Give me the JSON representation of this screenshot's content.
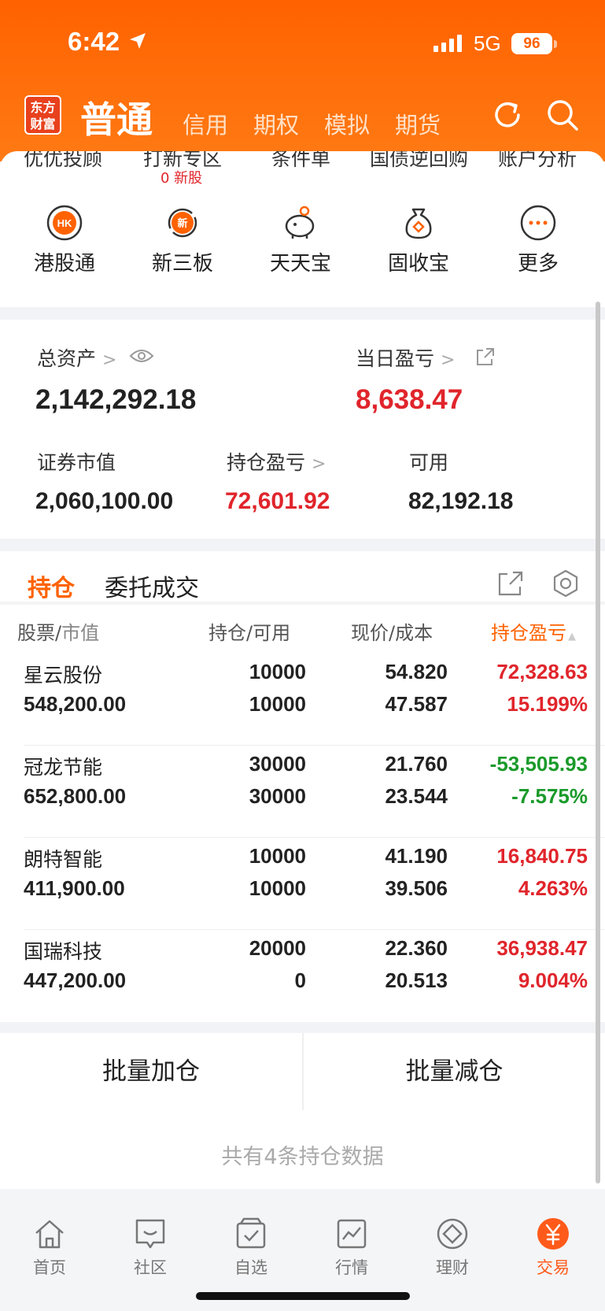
{
  "status": {
    "time": "6:42",
    "network": "5G",
    "battery": "96"
  },
  "header": {
    "logo": "东方财富",
    "tabs": [
      "普通",
      "信用",
      "期权",
      "模拟",
      "期货"
    ]
  },
  "quick": {
    "top_row": [
      "优优投顾",
      "打新专区",
      "条件单",
      "国债逆回购",
      "账户分析"
    ],
    "new_stock_count": "0 新股",
    "items": [
      {
        "label": "港股通",
        "icon": "hk-icon"
      },
      {
        "label": "新三板",
        "icon": "new-board-icon"
      },
      {
        "label": "天天宝",
        "icon": "piggy-bank-icon"
      },
      {
        "label": "固收宝",
        "icon": "money-bag-icon"
      },
      {
        "label": "更多",
        "icon": "more-icon"
      }
    ]
  },
  "assets": {
    "total_label": "总资产",
    "total_value": "2,142,292.18",
    "daily_label": "当日盈亏",
    "daily_value": "8,638.47",
    "market_label": "证券市值",
    "market_value": "2,060,100.00",
    "holding_pl_label": "持仓盈亏",
    "holding_pl_value": "72,601.92",
    "available_label": "可用",
    "available_value": "82,192.18"
  },
  "positions": {
    "tabs": [
      "持仓",
      "委托成交"
    ],
    "header": {
      "stock": "股票",
      "mv": "市值",
      "hold": "持仓",
      "avail": "可用",
      "price": "现价",
      "cost": "成本",
      "pl": "持仓盈亏"
    },
    "rows": [
      {
        "name": "星云股份",
        "mv": "548,200.00",
        "hold": "10000",
        "avail": "10000",
        "price": "54.820",
        "cost": "47.587",
        "pl": "72,328.63",
        "pct": "15.199%",
        "up": true
      },
      {
        "name": "冠龙节能",
        "mv": "652,800.00",
        "hold": "30000",
        "avail": "30000",
        "price": "21.760",
        "cost": "23.544",
        "pl": "-53,505.93",
        "pct": "-7.575%",
        "up": false
      },
      {
        "name": "朗特智能",
        "mv": "411,900.00",
        "hold": "10000",
        "avail": "10000",
        "price": "41.190",
        "cost": "39.506",
        "pl": "16,840.75",
        "pct": "4.263%",
        "up": true
      },
      {
        "name": "国瑞科技",
        "mv": "447,200.00",
        "hold": "20000",
        "avail": "0",
        "price": "22.360",
        "cost": "20.513",
        "pl": "36,938.47",
        "pct": "9.004%",
        "up": true
      }
    ],
    "batch_add": "批量加仓",
    "batch_reduce": "批量减仓",
    "summary": "共有4条持仓数据"
  },
  "nav": [
    {
      "label": "首页",
      "icon": "home-icon"
    },
    {
      "label": "社区",
      "icon": "community-icon"
    },
    {
      "label": "自选",
      "icon": "watchlist-icon"
    },
    {
      "label": "行情",
      "icon": "market-icon"
    },
    {
      "label": "理财",
      "icon": "wealth-icon"
    },
    {
      "label": "交易",
      "icon": "trade-icon"
    }
  ],
  "colors": {
    "brand": "#ff6200",
    "up": "#e0252b",
    "down": "#1a9a2a"
  }
}
